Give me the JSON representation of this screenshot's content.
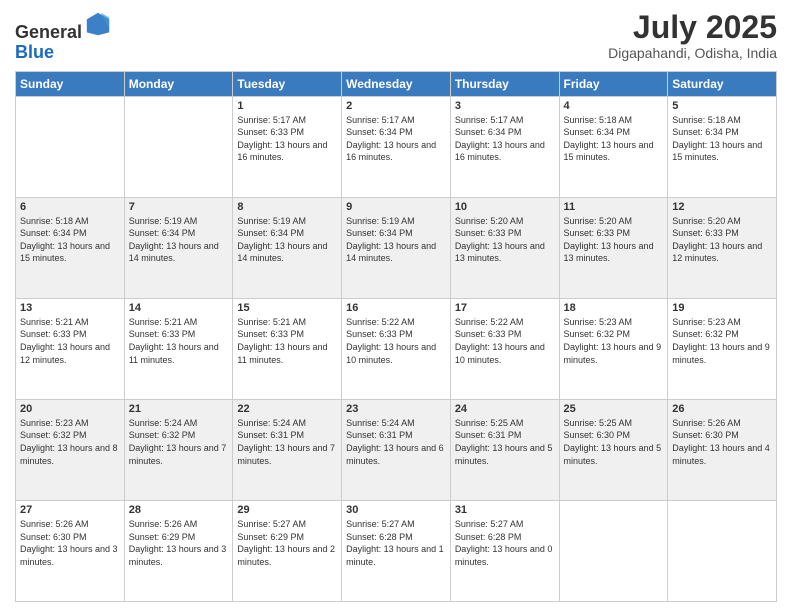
{
  "header": {
    "logo_line1": "General",
    "logo_line2": "Blue",
    "month": "July 2025",
    "location": "Digapahandi, Odisha, India"
  },
  "days_of_week": [
    "Sunday",
    "Monday",
    "Tuesday",
    "Wednesday",
    "Thursday",
    "Friday",
    "Saturday"
  ],
  "weeks": [
    [
      {
        "day": "",
        "info": ""
      },
      {
        "day": "",
        "info": ""
      },
      {
        "day": "1",
        "info": "Sunrise: 5:17 AM\nSunset: 6:33 PM\nDaylight: 13 hours and 16 minutes."
      },
      {
        "day": "2",
        "info": "Sunrise: 5:17 AM\nSunset: 6:34 PM\nDaylight: 13 hours and 16 minutes."
      },
      {
        "day": "3",
        "info": "Sunrise: 5:17 AM\nSunset: 6:34 PM\nDaylight: 13 hours and 16 minutes."
      },
      {
        "day": "4",
        "info": "Sunrise: 5:18 AM\nSunset: 6:34 PM\nDaylight: 13 hours and 15 minutes."
      },
      {
        "day": "5",
        "info": "Sunrise: 5:18 AM\nSunset: 6:34 PM\nDaylight: 13 hours and 15 minutes."
      }
    ],
    [
      {
        "day": "6",
        "info": "Sunrise: 5:18 AM\nSunset: 6:34 PM\nDaylight: 13 hours and 15 minutes."
      },
      {
        "day": "7",
        "info": "Sunrise: 5:19 AM\nSunset: 6:34 PM\nDaylight: 13 hours and 14 minutes."
      },
      {
        "day": "8",
        "info": "Sunrise: 5:19 AM\nSunset: 6:34 PM\nDaylight: 13 hours and 14 minutes."
      },
      {
        "day": "9",
        "info": "Sunrise: 5:19 AM\nSunset: 6:34 PM\nDaylight: 13 hours and 14 minutes."
      },
      {
        "day": "10",
        "info": "Sunrise: 5:20 AM\nSunset: 6:33 PM\nDaylight: 13 hours and 13 minutes."
      },
      {
        "day": "11",
        "info": "Sunrise: 5:20 AM\nSunset: 6:33 PM\nDaylight: 13 hours and 13 minutes."
      },
      {
        "day": "12",
        "info": "Sunrise: 5:20 AM\nSunset: 6:33 PM\nDaylight: 13 hours and 12 minutes."
      }
    ],
    [
      {
        "day": "13",
        "info": "Sunrise: 5:21 AM\nSunset: 6:33 PM\nDaylight: 13 hours and 12 minutes."
      },
      {
        "day": "14",
        "info": "Sunrise: 5:21 AM\nSunset: 6:33 PM\nDaylight: 13 hours and 11 minutes."
      },
      {
        "day": "15",
        "info": "Sunrise: 5:21 AM\nSunset: 6:33 PM\nDaylight: 13 hours and 11 minutes."
      },
      {
        "day": "16",
        "info": "Sunrise: 5:22 AM\nSunset: 6:33 PM\nDaylight: 13 hours and 10 minutes."
      },
      {
        "day": "17",
        "info": "Sunrise: 5:22 AM\nSunset: 6:33 PM\nDaylight: 13 hours and 10 minutes."
      },
      {
        "day": "18",
        "info": "Sunrise: 5:23 AM\nSunset: 6:32 PM\nDaylight: 13 hours and 9 minutes."
      },
      {
        "day": "19",
        "info": "Sunrise: 5:23 AM\nSunset: 6:32 PM\nDaylight: 13 hours and 9 minutes."
      }
    ],
    [
      {
        "day": "20",
        "info": "Sunrise: 5:23 AM\nSunset: 6:32 PM\nDaylight: 13 hours and 8 minutes."
      },
      {
        "day": "21",
        "info": "Sunrise: 5:24 AM\nSunset: 6:32 PM\nDaylight: 13 hours and 7 minutes."
      },
      {
        "day": "22",
        "info": "Sunrise: 5:24 AM\nSunset: 6:31 PM\nDaylight: 13 hours and 7 minutes."
      },
      {
        "day": "23",
        "info": "Sunrise: 5:24 AM\nSunset: 6:31 PM\nDaylight: 13 hours and 6 minutes."
      },
      {
        "day": "24",
        "info": "Sunrise: 5:25 AM\nSunset: 6:31 PM\nDaylight: 13 hours and 5 minutes."
      },
      {
        "day": "25",
        "info": "Sunrise: 5:25 AM\nSunset: 6:30 PM\nDaylight: 13 hours and 5 minutes."
      },
      {
        "day": "26",
        "info": "Sunrise: 5:26 AM\nSunset: 6:30 PM\nDaylight: 13 hours and 4 minutes."
      }
    ],
    [
      {
        "day": "27",
        "info": "Sunrise: 5:26 AM\nSunset: 6:30 PM\nDaylight: 13 hours and 3 minutes."
      },
      {
        "day": "28",
        "info": "Sunrise: 5:26 AM\nSunset: 6:29 PM\nDaylight: 13 hours and 3 minutes."
      },
      {
        "day": "29",
        "info": "Sunrise: 5:27 AM\nSunset: 6:29 PM\nDaylight: 13 hours and 2 minutes."
      },
      {
        "day": "30",
        "info": "Sunrise: 5:27 AM\nSunset: 6:28 PM\nDaylight: 13 hours and 1 minute."
      },
      {
        "day": "31",
        "info": "Sunrise: 5:27 AM\nSunset: 6:28 PM\nDaylight: 13 hours and 0 minutes."
      },
      {
        "day": "",
        "info": ""
      },
      {
        "day": "",
        "info": ""
      }
    ]
  ]
}
